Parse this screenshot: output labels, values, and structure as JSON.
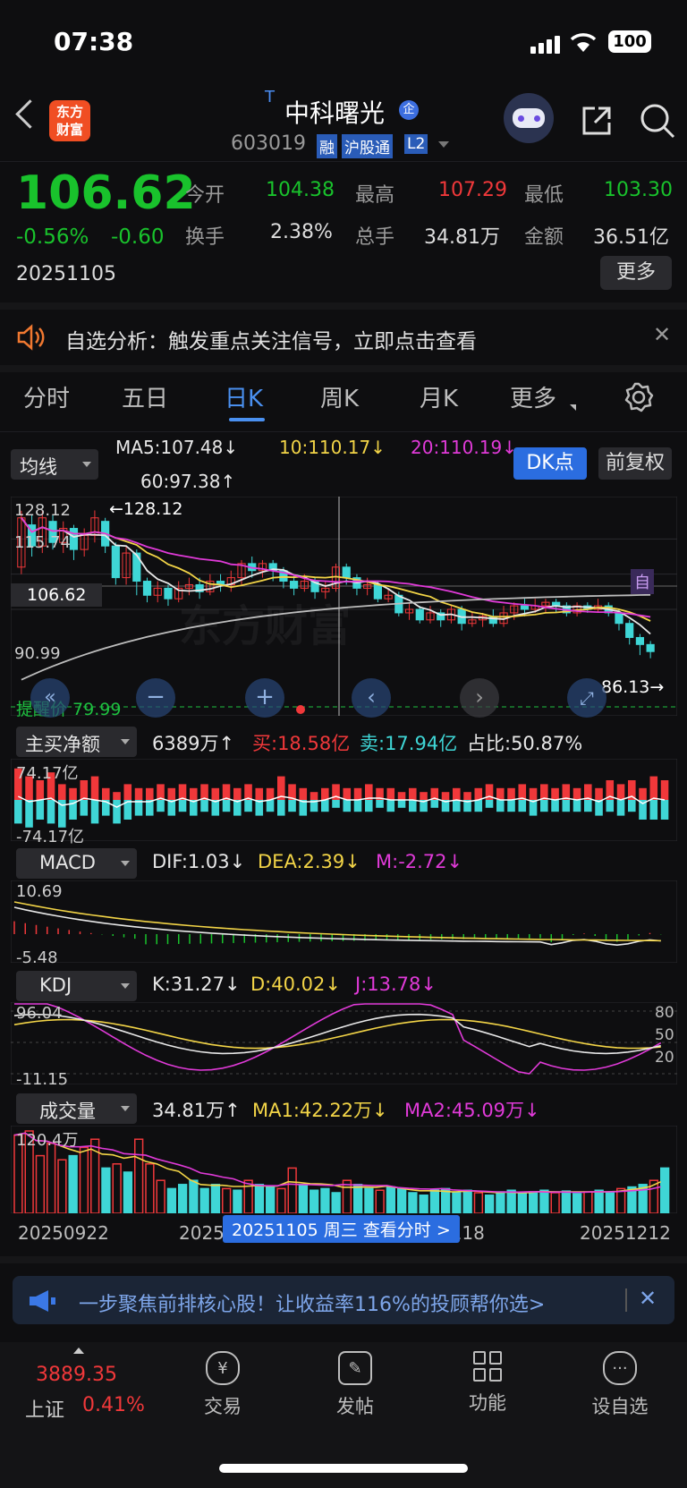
{
  "status_bar": {
    "time": "07:38",
    "battery": "100"
  },
  "header": {
    "logo_line1": "东方",
    "logo_line2": "财富",
    "t_mark": "T",
    "stock_name": "中科曙光",
    "badge_qi": "企",
    "stock_code": "603019",
    "tag_rong": "融",
    "tag_hgt": "沪股通",
    "tag_l2": "L2"
  },
  "quote": {
    "price": "106.62",
    "change_pct": "-0.56%",
    "change": "-0.60",
    "date": "20251105",
    "open_label": "今开",
    "open": "104.38",
    "high_label": "最高",
    "high": "107.29",
    "low_label": "最低",
    "low": "103.30",
    "turnover_label": "换手",
    "turnover": "2.38%",
    "volume_label": "总手",
    "volume": "34.81万",
    "amount_label": "金额",
    "amount": "36.51亿",
    "more": "更多"
  },
  "notice": {
    "text": "自选分析：触发重点关注信号，立即点击查看"
  },
  "tabs": [
    "分时",
    "五日",
    "日K",
    "周K",
    "月K",
    "更多"
  ],
  "active_tab": 2,
  "ma_row": {
    "dropdown": "均线",
    "ma5": "MA5:107.48↓",
    "ma10": "10:110.17↓",
    "ma20": "20:110.19↓",
    "ma60": "60:97.38↑",
    "dk_btn": "DK点",
    "fq_btn": "前复权"
  },
  "kline": {
    "top_label": "128.12",
    "peak_label": "←128.12",
    "mid_label": "115.74",
    "cur_price_label": "106.62",
    "low_axis_label": "90.99",
    "min_label": "86.13→",
    "alert_label": "提醒价 79.99",
    "zi_label": "自",
    "watermark": "东方财富",
    "candles": [
      {
        "o": 112,
        "c": 126,
        "h": 128,
        "l": 110
      },
      {
        "o": 124,
        "c": 118,
        "h": 127,
        "l": 115
      },
      {
        "o": 118,
        "c": 126,
        "h": 128,
        "l": 116
      },
      {
        "o": 125,
        "c": 119,
        "h": 127,
        "l": 117
      },
      {
        "o": 119,
        "c": 123,
        "h": 125,
        "l": 116
      },
      {
        "o": 123,
        "c": 117,
        "h": 124,
        "l": 114
      },
      {
        "o": 117,
        "c": 121,
        "h": 123,
        "l": 115
      },
      {
        "o": 121,
        "c": 126,
        "h": 128.1,
        "l": 119
      },
      {
        "o": 125,
        "c": 118,
        "h": 126,
        "l": 116
      },
      {
        "o": 118,
        "c": 109,
        "h": 119,
        "l": 107
      },
      {
        "o": 109,
        "c": 116,
        "h": 118,
        "l": 107
      },
      {
        "o": 116,
        "c": 108,
        "h": 117,
        "l": 104
      },
      {
        "o": 108,
        "c": 104,
        "h": 109,
        "l": 102
      },
      {
        "o": 104,
        "c": 106,
        "h": 108,
        "l": 102
      },
      {
        "o": 106,
        "c": 103,
        "h": 107,
        "l": 101
      },
      {
        "o": 103,
        "c": 106,
        "h": 108,
        "l": 102
      },
      {
        "o": 106,
        "c": 107,
        "h": 109,
        "l": 104
      },
      {
        "o": 107,
        "c": 105,
        "h": 109,
        "l": 103
      },
      {
        "o": 105,
        "c": 108,
        "h": 110,
        "l": 104
      },
      {
        "o": 108,
        "c": 107,
        "h": 110,
        "l": 105
      },
      {
        "o": 107,
        "c": 109,
        "h": 111,
        "l": 105
      },
      {
        "o": 109,
        "c": 113,
        "h": 114,
        "l": 107
      },
      {
        "o": 113,
        "c": 111,
        "h": 115,
        "l": 109
      },
      {
        "o": 111,
        "c": 113,
        "h": 114,
        "l": 109
      },
      {
        "o": 113,
        "c": 111,
        "h": 114,
        "l": 108
      },
      {
        "o": 111,
        "c": 108,
        "h": 112,
        "l": 106
      },
      {
        "o": 108,
        "c": 106,
        "h": 110,
        "l": 104
      },
      {
        "o": 106,
        "c": 108,
        "h": 110,
        "l": 105
      },
      {
        "o": 108,
        "c": 105,
        "h": 109,
        "l": 103
      },
      {
        "o": 105,
        "c": 106,
        "h": 108,
        "l": 103
      },
      {
        "o": 106,
        "c": 112,
        "h": 113,
        "l": 105
      },
      {
        "o": 112,
        "c": 109,
        "h": 113,
        "l": 107
      },
      {
        "o": 109,
        "c": 106,
        "h": 110,
        "l": 104
      },
      {
        "o": 106,
        "c": 107,
        "h": 109,
        "l": 104
      },
      {
        "o": 107,
        "c": 103,
        "h": 108,
        "l": 102
      },
      {
        "o": 103,
        "c": 104,
        "h": 106,
        "l": 102
      },
      {
        "o": 104,
        "c": 99,
        "h": 105,
        "l": 98
      },
      {
        "o": 99,
        "c": 100,
        "h": 102,
        "l": 97
      },
      {
        "o": 100,
        "c": 97,
        "h": 101,
        "l": 96
      },
      {
        "o": 97,
        "c": 99,
        "h": 101,
        "l": 96
      },
      {
        "o": 99,
        "c": 97,
        "h": 100,
        "l": 95
      },
      {
        "o": 97,
        "c": 100,
        "h": 101,
        "l": 96
      },
      {
        "o": 100,
        "c": 96,
        "h": 101,
        "l": 94
      },
      {
        "o": 96,
        "c": 97,
        "h": 99,
        "l": 95
      },
      {
        "o": 97,
        "c": 98,
        "h": 99,
        "l": 95
      },
      {
        "o": 98,
        "c": 96,
        "h": 100,
        "l": 95
      },
      {
        "o": 96,
        "c": 99,
        "h": 101,
        "l": 95
      },
      {
        "o": 99,
        "c": 101,
        "h": 102,
        "l": 97
      },
      {
        "o": 101,
        "c": 100,
        "h": 103,
        "l": 98
      },
      {
        "o": 100,
        "c": 101,
        "h": 103,
        "l": 99
      },
      {
        "o": 101,
        "c": 102,
        "h": 103,
        "l": 99
      },
      {
        "o": 102,
        "c": 101,
        "h": 103,
        "l": 99
      },
      {
        "o": 101,
        "c": 99,
        "h": 102,
        "l": 98
      },
      {
        "o": 99,
        "c": 101,
        "h": 102,
        "l": 98
      },
      {
        "o": 101,
        "c": 100,
        "h": 102,
        "l": 99
      },
      {
        "o": 100,
        "c": 101,
        "h": 103,
        "l": 99
      },
      {
        "o": 101,
        "c": 99,
        "h": 102,
        "l": 98
      },
      {
        "o": 99,
        "c": 96,
        "h": 100,
        "l": 94
      },
      {
        "o": 96,
        "c": 92,
        "h": 97,
        "l": 90
      },
      {
        "o": 92,
        "c": 90,
        "h": 93,
        "l": 87
      },
      {
        "o": 90,
        "c": 88,
        "h": 91,
        "l": 86.1
      }
    ]
  },
  "flow": {
    "dropdown": "主买净额",
    "net": "6389万↑",
    "buy": "买:18.58亿",
    "sell": "卖:17.94亿",
    "ratio": "占比:50.87%",
    "top_label": "74.17亿",
    "bot_label": "-74.17亿",
    "buy_vals": [
      0.8,
      0.6,
      0.5,
      0.7,
      0.4,
      0.3,
      0.5,
      0.6,
      0.3,
      0.2,
      0.4,
      0.3,
      0.3,
      0.4,
      0.3,
      0.4,
      0.3,
      0.4,
      0.3,
      0.4,
      0.3,
      0.4,
      0.3,
      0.3,
      0.6,
      0.4,
      0.3,
      0.2,
      0.3,
      0.4,
      0.3,
      0.3,
      0.4,
      0.3,
      0.3,
      0.2,
      0.3,
      0.2,
      0.3,
      0.2,
      0.3,
      0.2,
      0.3,
      0.4,
      0.3,
      0.3,
      0.4,
      0.3,
      0.4,
      0.3,
      0.4,
      0.3,
      0.4,
      0.3,
      0.5,
      0.4,
      0.5,
      0.3,
      0.6,
      0.5
    ],
    "sell_vals": [
      0.6,
      0.7,
      0.5,
      0.6,
      0.7,
      0.5,
      0.4,
      0.6,
      0.4,
      0.6,
      0.5,
      0.4,
      0.4,
      0.3,
      0.4,
      0.3,
      0.4,
      0.3,
      0.4,
      0.3,
      0.4,
      0.3,
      0.4,
      0.3,
      0.4,
      0.3,
      0.4,
      0.3,
      0.3,
      0.2,
      0.3,
      0.3,
      0.3,
      0.2,
      0.3,
      0.2,
      0.3,
      0.3,
      0.2,
      0.3,
      0.3,
      0.3,
      0.3,
      0.2,
      0.3,
      0.3,
      0.3,
      0.4,
      0.3,
      0.3,
      0.3,
      0.3,
      0.3,
      0.4,
      0.3,
      0.4,
      0.3,
      0.5,
      0.5,
      0.5
    ]
  },
  "macd": {
    "dropdown": "MACD",
    "dif": "DIF:1.03↓",
    "dea": "DEA:2.39↓",
    "m": "M:-2.72↓",
    "top_label": "10.69",
    "bot_label": "-5.48"
  },
  "kdj": {
    "dropdown": "KDJ",
    "k": "K:31.27↓",
    "d": "D:40.02↓",
    "j": "J:13.78↓",
    "top_label": "96.04",
    "bot_label": "-11.15",
    "r80": "80",
    "r50": "50",
    "r20": "20"
  },
  "vol": {
    "dropdown": "成交量",
    "v": "34.81万↑",
    "ma1": "MA1:42.22万↓",
    "ma2": "MA2:45.09万↓",
    "top_label": "120.4万",
    "dates": [
      "20250922",
      "20251020",
      "20251118",
      "20251212"
    ],
    "tooltip": "20251105 周三 查看分时 >",
    "vals": [
      95,
      100,
      70,
      85,
      65,
      70,
      80,
      90,
      55,
      60,
      50,
      90,
      60,
      40,
      30,
      35,
      40,
      30,
      35,
      30,
      28,
      40,
      35,
      32,
      30,
      55,
      35,
      28,
      30,
      25,
      40,
      35,
      30,
      28,
      32,
      30,
      25,
      22,
      28,
      30,
      25,
      28,
      25,
      22,
      26,
      28,
      24,
      26,
      28,
      25,
      27,
      24,
      26,
      28,
      25,
      30,
      32,
      35,
      40,
      55
    ],
    "red_idx": [
      0,
      1,
      2,
      3,
      4,
      6,
      7,
      9,
      11,
      12,
      13,
      19,
      21,
      24,
      25,
      30,
      33,
      42,
      49,
      52,
      55,
      58
    ]
  },
  "banner": {
    "text": "一步聚焦前排核心股！让收益率116%的投顾帮你选>"
  },
  "bottom_nav": {
    "index_value": "3889.35",
    "index_name": "上证",
    "index_change": "0.41%",
    "trade": "交易",
    "post": "发帖",
    "func": "功能",
    "watch": "设自选"
  }
}
